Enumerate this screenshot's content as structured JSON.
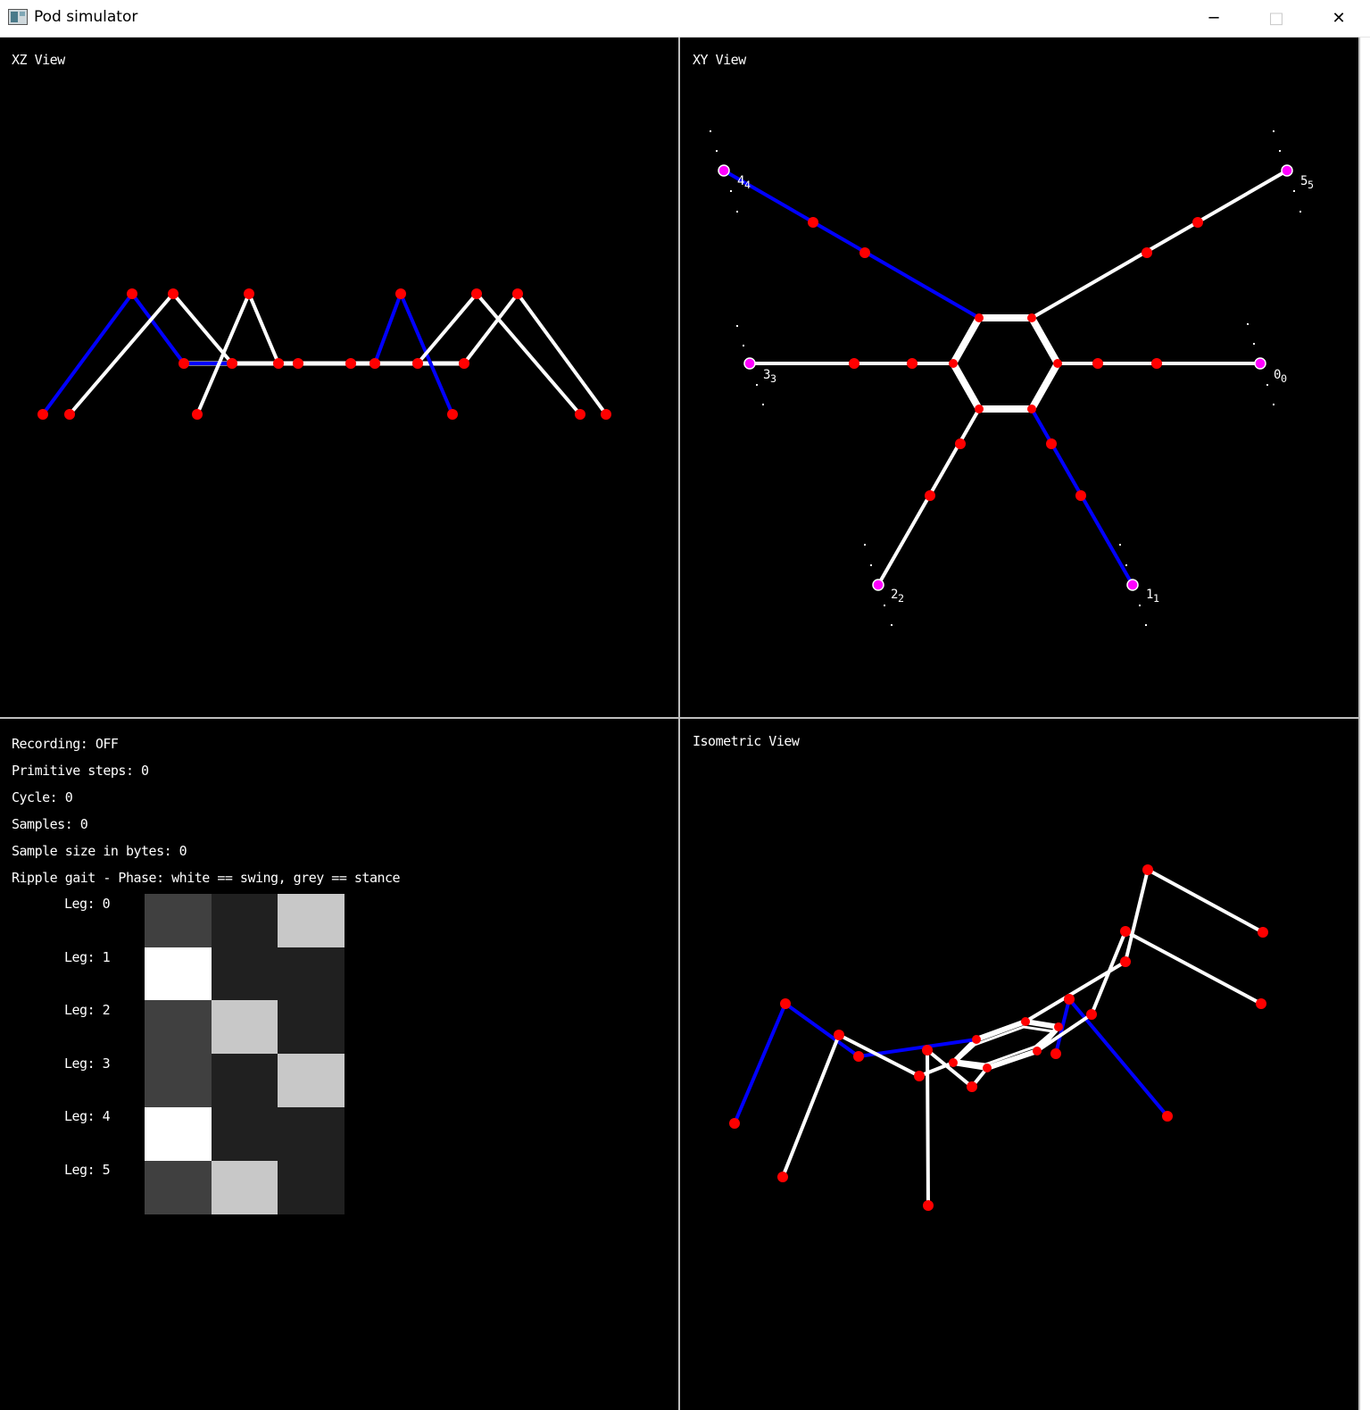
{
  "window": {
    "title": "Pod simulator",
    "minimize_symbol": "─",
    "maximize_symbol": "□",
    "close_symbol": "✕"
  },
  "views": {
    "xz": {
      "label": "XZ View"
    },
    "xy": {
      "label": "XY View",
      "leg_numbers": [
        {
          "id": "0",
          "sub": "0"
        },
        {
          "id": "1",
          "sub": "1"
        },
        {
          "id": "2",
          "sub": "2"
        },
        {
          "id": "3",
          "sub": "3"
        },
        {
          "id": "4",
          "sub": "4"
        },
        {
          "id": "5",
          "sub": "5"
        }
      ]
    },
    "iso": {
      "label": "Isometric View"
    }
  },
  "info": {
    "recording": "Recording: OFF",
    "primitive_steps": "Primitive steps: 0",
    "cycle": "Cycle: 0",
    "samples": "Samples: 0",
    "sample_size": "Sample size in bytes: 0",
    "gait": "Ripple gait - Phase: white == swing, grey == stance"
  },
  "gait_table": {
    "legs": [
      "Leg: 0",
      "Leg: 1",
      "Leg: 2",
      "Leg: 3",
      "Leg: 4",
      "Leg: 5"
    ],
    "cells": [
      [
        "#404040",
        "#202020",
        "#c8c8c8"
      ],
      [
        "#ffffff",
        "#202020",
        "#202020"
      ],
      [
        "#404040",
        "#c8c8c8",
        "#202020"
      ],
      [
        "#404040",
        "#202020",
        "#c8c8c8"
      ],
      [
        "#ffffff",
        "#202020",
        "#202020"
      ],
      [
        "#404040",
        "#c8c8c8",
        "#202020"
      ]
    ]
  },
  "colors": {
    "background": "#000000",
    "swing_leg": "#0000ff",
    "stance_leg": "#ffffff",
    "joint": "#ff0000",
    "foot_target": "#ff00ff"
  }
}
